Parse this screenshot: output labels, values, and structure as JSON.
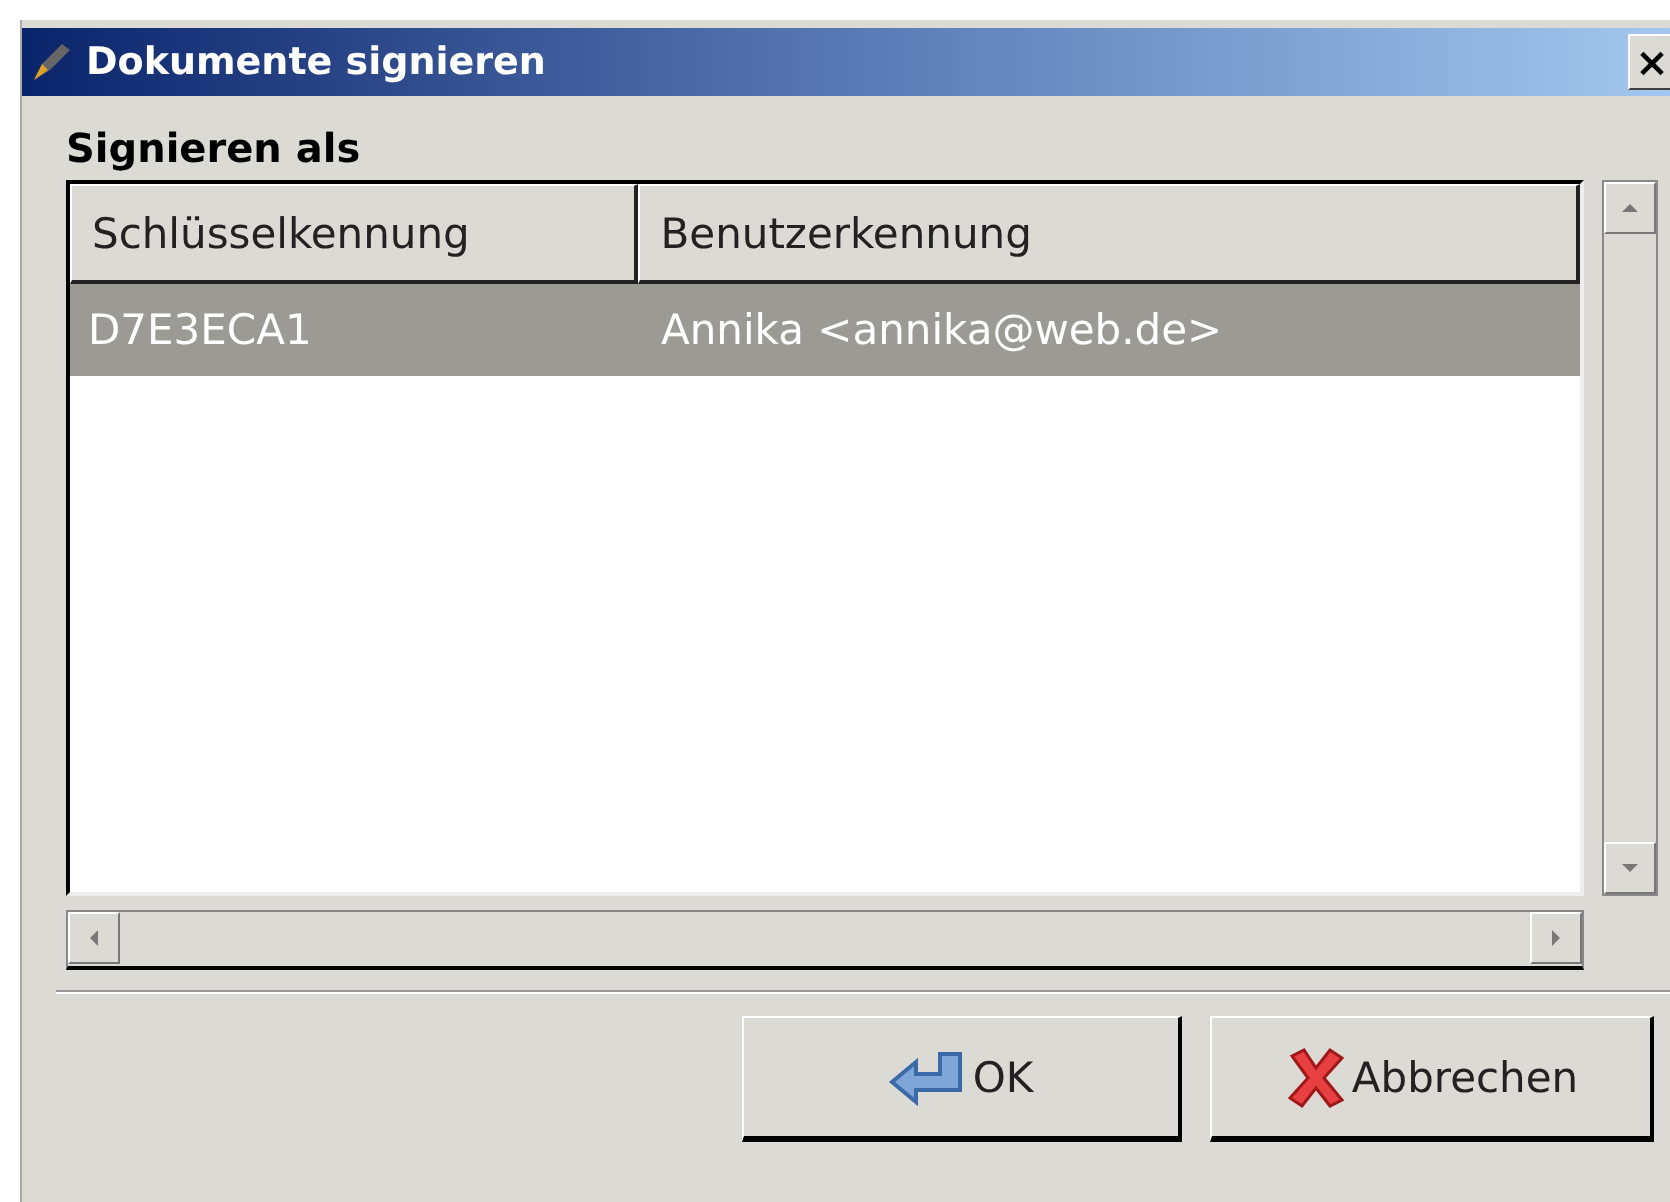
{
  "window": {
    "title": "Dokumente signieren",
    "close": "×"
  },
  "section_label": "Signieren als",
  "table": {
    "columns": [
      "Schlüsselkennung",
      "Benutzerkennung"
    ],
    "rows": [
      {
        "cells": [
          "D7E3ECA1",
          "Annika <annika@web.de>"
        ],
        "selected": true
      }
    ]
  },
  "buttons": [
    {
      "kind": "ok",
      "label": "OK"
    },
    {
      "kind": "cancel",
      "label": "Abbrechen"
    }
  ]
}
